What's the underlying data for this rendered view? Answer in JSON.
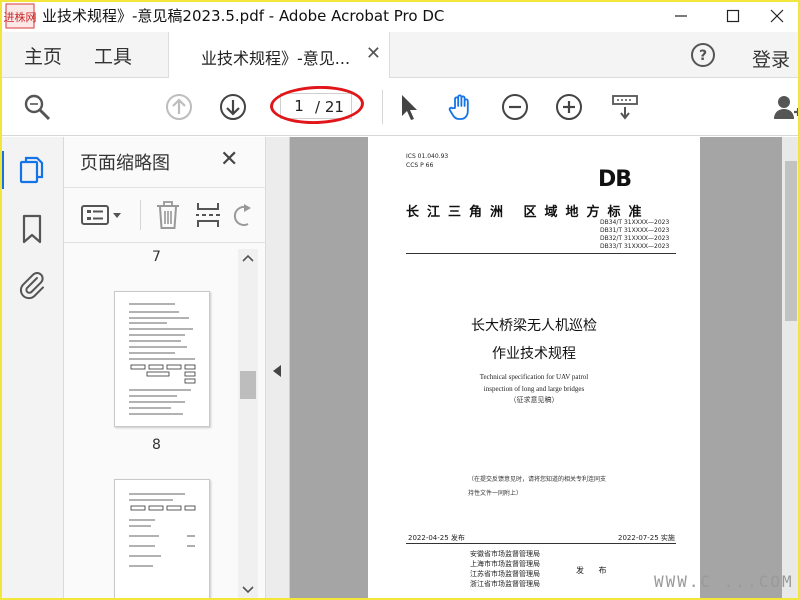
{
  "window": {
    "title": "业技术规程》-意见稿2023.5.pdf - Adobe Acrobat Pro DC",
    "logo_text": "进株网"
  },
  "menu": {
    "home": "主页",
    "tools": "工具",
    "doc_tab": "业技术规程》-意见...",
    "login": "登录"
  },
  "toolbar": {
    "current_page": "1",
    "total_pages": "/ 21"
  },
  "panel": {
    "title": "页面缩略图",
    "thumbnails": [
      {
        "label": "7"
      },
      {
        "label": "8"
      }
    ]
  },
  "document": {
    "ics": "ICS  01.040.93",
    "ccs": "CCS  P 66",
    "db_mark": "DB",
    "org": "长江三角洲  区域地方标准",
    "codes": [
      "DB34/T 31XXXX—2023",
      "DB31/T 31XXXX—2023",
      "DB32/T 31XXXX—2023",
      "DB33/T 31XXXX—2023"
    ],
    "title_line1": "长大桥梁无人机巡检",
    "title_line2": "作业技术规程",
    "english_line1": "Technical specification for UAV patrol",
    "english_line2": "inspection of long and large bridges",
    "draft_note": "（征求意见稿）",
    "note_line1": "（在提交反馈意见时，请将您知道的相关专利连同支",
    "note_line2": "持性文件一同附上）",
    "publish_date": "2022-04-25 发布",
    "implement_date": "2022-07-25 实施",
    "issuers": [
      "安徽省市场监督管理局",
      "上海市市场监督管理局",
      "江苏省市场监督管理局",
      "浙江省市场监督管理局"
    ],
    "issue_word": "发 布"
  },
  "watermark": "WWW.C      ...COM",
  "colors": {
    "accent": "#1473e6",
    "annotation_ring": "#e0161a",
    "frame": "#f2e63a"
  }
}
